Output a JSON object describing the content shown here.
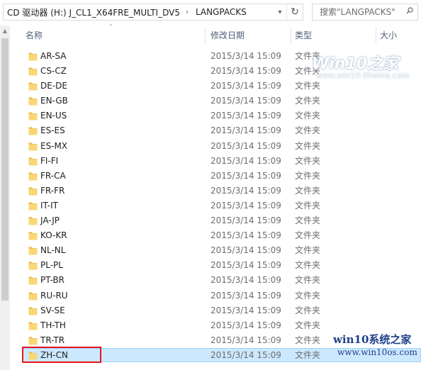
{
  "address": {
    "crumbs": [
      "CD 驱动器 (H:) J_CL1_X64FRE_MULTI_DV5",
      "LANGPACKS"
    ],
    "refresh_icon": "refresh-icon"
  },
  "search": {
    "placeholder": "搜索\"LANGPACKS\""
  },
  "columns": {
    "name": "名称",
    "date": "修改日期",
    "type": "类型",
    "size": "大小"
  },
  "files": [
    {
      "name": "AR-SA",
      "date": "2015/3/14 15:09",
      "type": "文件夹"
    },
    {
      "name": "CS-CZ",
      "date": "2015/3/14 15:09",
      "type": "文件夹"
    },
    {
      "name": "DE-DE",
      "date": "2015/3/14 15:09",
      "type": "文件夹"
    },
    {
      "name": "EN-GB",
      "date": "2015/3/14 15:09",
      "type": "文件夹"
    },
    {
      "name": "EN-US",
      "date": "2015/3/14 15:09",
      "type": "文件夹"
    },
    {
      "name": "ES-ES",
      "date": "2015/3/14 15:09",
      "type": "文件夹"
    },
    {
      "name": "ES-MX",
      "date": "2015/3/14 15:09",
      "type": "文件夹"
    },
    {
      "name": "FI-FI",
      "date": "2015/3/14 15:09",
      "type": "文件夹"
    },
    {
      "name": "FR-CA",
      "date": "2015/3/14 15:09",
      "type": "文件夹"
    },
    {
      "name": "FR-FR",
      "date": "2015/3/14 15:09",
      "type": "文件夹"
    },
    {
      "name": "IT-IT",
      "date": "2015/3/14 15:09",
      "type": "文件夹"
    },
    {
      "name": "JA-JP",
      "date": "2015/3/14 15:09",
      "type": "文件夹"
    },
    {
      "name": "KO-KR",
      "date": "2015/3/14 15:09",
      "type": "文件夹"
    },
    {
      "name": "NL-NL",
      "date": "2015/3/14 15:09",
      "type": "文件夹"
    },
    {
      "name": "PL-PL",
      "date": "2015/3/14 15:09",
      "type": "文件夹"
    },
    {
      "name": "PT-BR",
      "date": "2015/3/14 15:09",
      "type": "文件夹"
    },
    {
      "name": "RU-RU",
      "date": "2015/3/14 15:09",
      "type": "文件夹"
    },
    {
      "name": "SV-SE",
      "date": "2015/3/14 15:09",
      "type": "文件夹"
    },
    {
      "name": "TH-TH",
      "date": "2015/3/14 15:09",
      "type": "文件夹"
    },
    {
      "name": "TR-TR",
      "date": "2015/3/14 15:09",
      "type": "文件夹"
    },
    {
      "name": "ZH-CN",
      "date": "2015/3/14 15:09",
      "type": "文件夹",
      "selected": true
    }
  ],
  "watermark_top": {
    "main": "Win10之家",
    "sub": "www.win10.ithome.com"
  },
  "watermark_bottom": {
    "main": "win10系统之家",
    "sub": "www.win10os.com"
  },
  "colors": {
    "selection": "#cce8ff",
    "highlight_box": "#e8161b",
    "folder": "#f8d775"
  }
}
